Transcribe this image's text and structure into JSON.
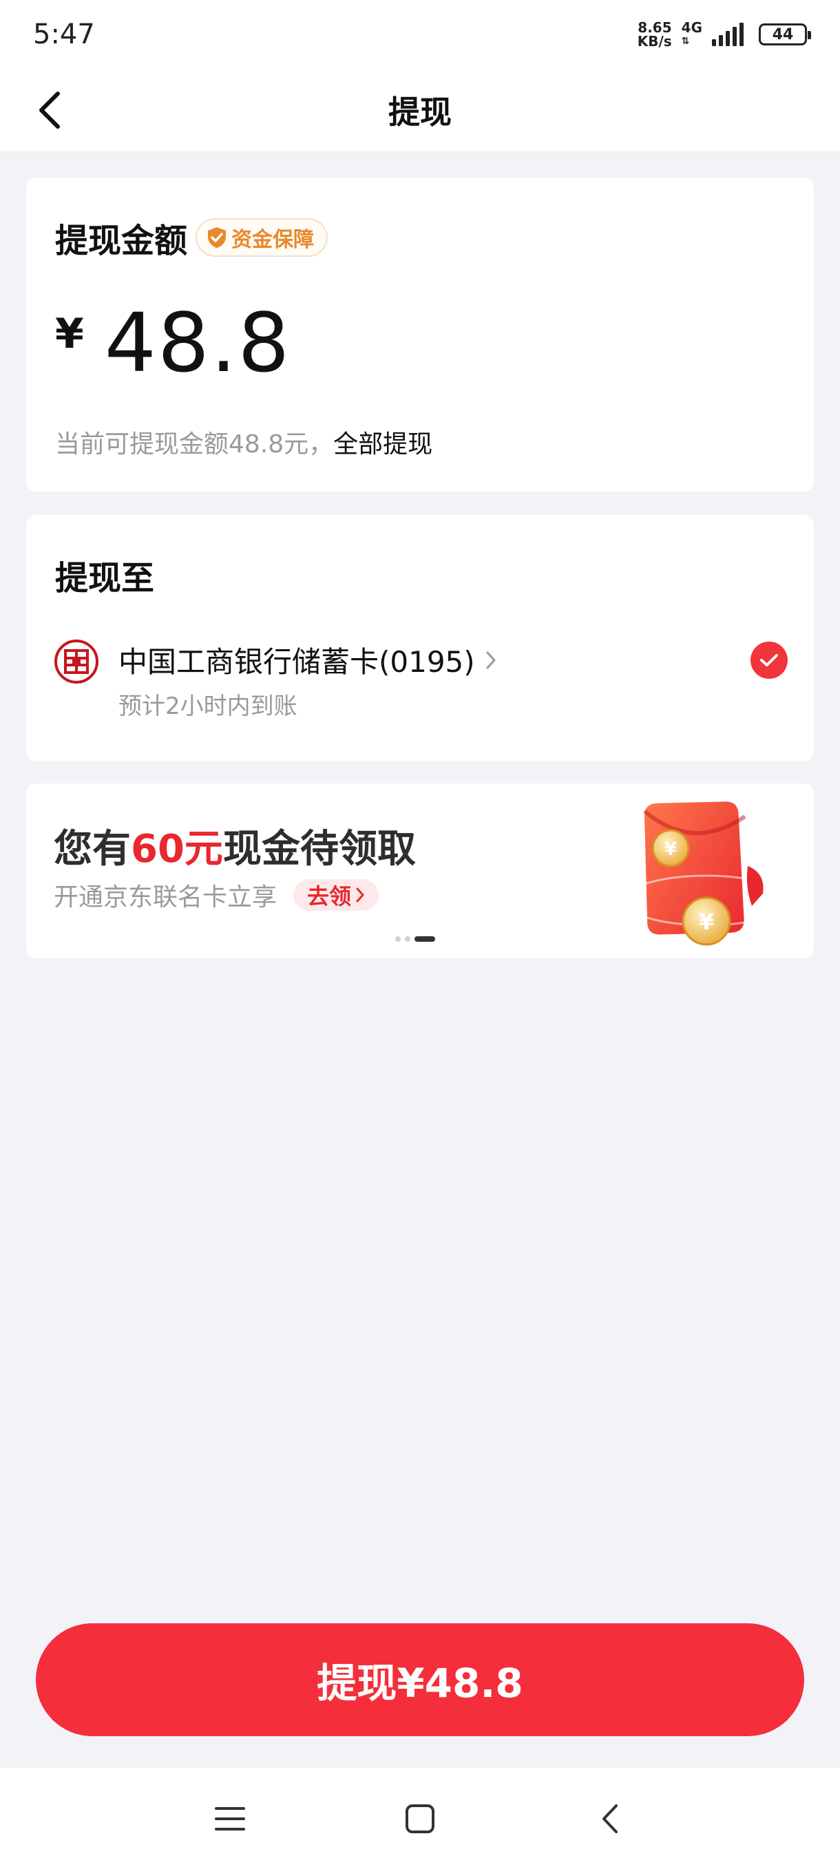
{
  "status": {
    "time": "5:47",
    "speed_value": "8.65",
    "speed_unit": "KB/s",
    "network": "4G",
    "battery": "44"
  },
  "nav": {
    "title": "提现"
  },
  "amount_card": {
    "title": "提现金额",
    "badge": "资金保障",
    "currency": "¥",
    "amount": "48.8",
    "available_text": "当前可提现金额48.8元，",
    "withdraw_all": "全部提现"
  },
  "to_card": {
    "title": "提现至",
    "bank_name": "中国工商银行储蓄卡(0195)",
    "arrival": "预计2小时内到账",
    "selected": true
  },
  "promo": {
    "prefix": "您有",
    "highlight": "60元",
    "suffix": "现金待领取",
    "subtitle": "开通京东联名卡立享",
    "cta": "去领",
    "page_count": 3,
    "active_page": 3
  },
  "action": {
    "label": "提现¥48.8"
  },
  "colors": {
    "brand_red": "#F42F3B",
    "badge_orange": "#E8892B",
    "bank_red": "#C7161E"
  }
}
